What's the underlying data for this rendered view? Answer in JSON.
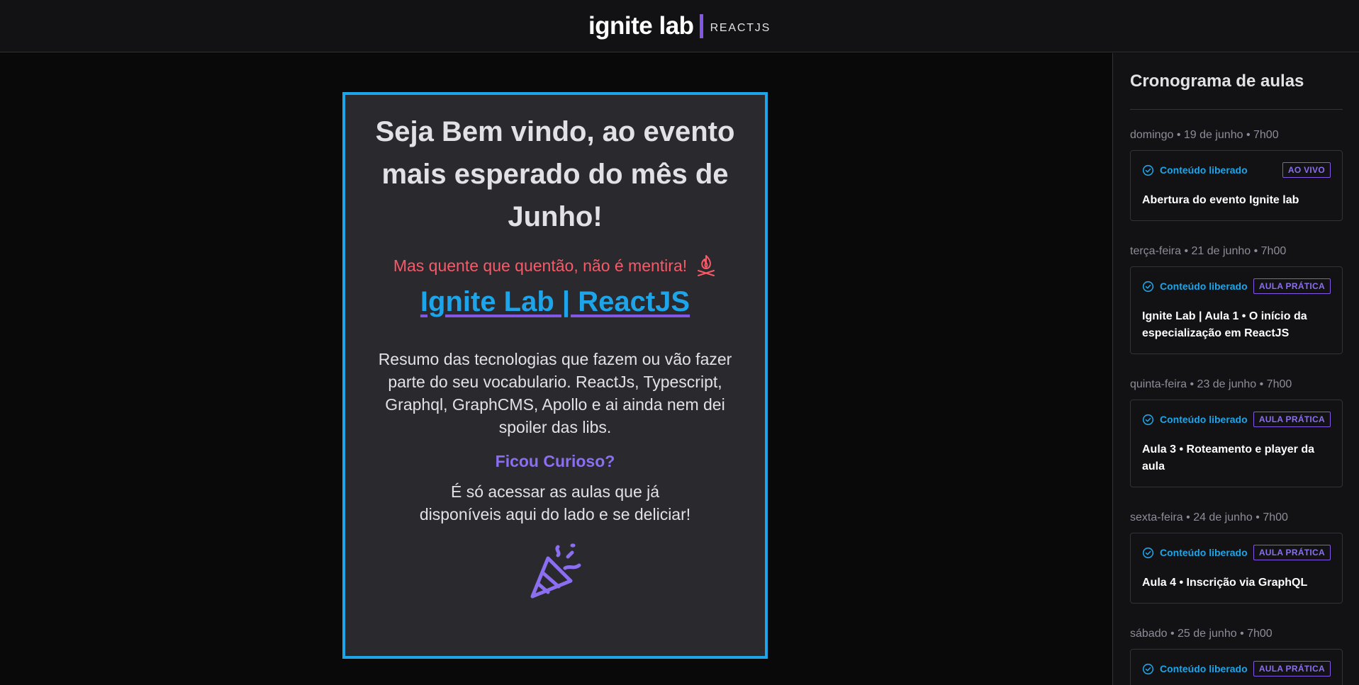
{
  "header": {
    "logo_main": "ignite lab",
    "logo_sub": "REACTJS"
  },
  "main": {
    "welcome": "Seja Bem vindo, ao evento mais esperado do mês de Junho!",
    "hot_text": "Mas quente que quentão, não é mentira!",
    "hot_icon": "campfire-icon",
    "title_link": "Ignite Lab | ReactJS",
    "summary": "Resumo das tecnologias que fazem ou vão fazer parte do seu vocabulario. ReactJs, Typescript, Graphql, GraphCMS, Apollo e ai ainda nem dei spoiler das libs.",
    "curious": "Ficou Curioso?",
    "access": "É só acessar as aulas que já disponíveis aqui do lado e se deliciar!",
    "confetti_icon": "confetti-icon"
  },
  "sidebar": {
    "title": "Cronograma de aulas",
    "lessons": [
      {
        "date": "domingo • 19 de junho • 7h00",
        "status": "Conteúdo liberado",
        "badge": "AO VIVO",
        "title": "Abertura do evento Ignite lab"
      },
      {
        "date": "terça-feira • 21 de junho • 7h00",
        "status": "Conteúdo liberado",
        "badge": "AULA PRÁTICA",
        "title": "Ignite Lab | Aula 1 • O início da especialização em ReactJS"
      },
      {
        "date": "quinta-feira • 23 de junho • 7h00",
        "status": "Conteúdo liberado",
        "badge": "AULA PRÁTICA",
        "title": "Aula 3 • Roteamento e player da aula"
      },
      {
        "date": "sexta-feira • 24 de junho • 7h00",
        "status": "Conteúdo liberado",
        "badge": "AULA PRÁTICA",
        "title": "Aula 4 • Inscrição via GraphQL"
      },
      {
        "date": "sábado • 25 de junho • 7h00",
        "status": "Conteúdo liberado",
        "badge": "AULA PRÁTICA",
        "title": ""
      }
    ]
  },
  "colors": {
    "accent_blue": "#1ea5e9",
    "accent_purple": "#8257e5",
    "hot_red": "#f75a68"
  }
}
